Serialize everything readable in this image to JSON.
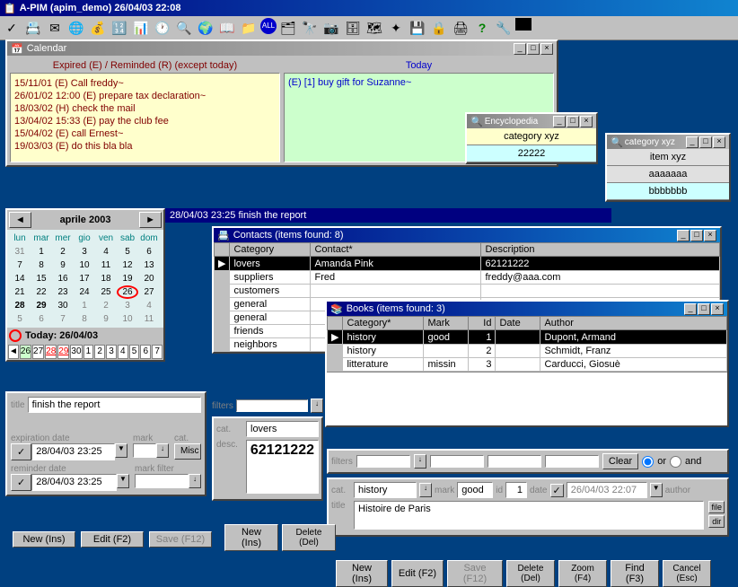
{
  "main_title": "A-PIM (apim_demo) 26/04/03 22:08",
  "calendar": {
    "title": "Calendar",
    "expired_header": "Expired (E) / Reminded (R) (except today)",
    "today_header": "Today",
    "expired_items": [
      "15/11/01 (E) Call freddy~",
      "26/01/02 12:00 (E) prepare tax declaration~",
      "18/03/02 (H) check the mail",
      "13/04/02 15:33 (E) pay the club fee",
      "15/04/02 (E) call Ernest~",
      "19/03/03 (E) do this bla bla"
    ],
    "today_items": [
      "(E) [1] buy gift for Suzanne~"
    ]
  },
  "encyclopedia": {
    "title": "Encyclopedia",
    "rows": [
      "category xyz",
      "22222"
    ]
  },
  "category_popup": {
    "title": "category xyz",
    "items": [
      "item xyz",
      "aaaaaaa",
      "bbbbbbb"
    ]
  },
  "month_task": "28/04/03 23:25 finish the report",
  "month_nav": {
    "label": "aprile 2003",
    "today_label": "Today: 26/04/03"
  },
  "cal_headers": [
    "lun",
    "mar",
    "mer",
    "gio",
    "ven",
    "sab",
    "dom"
  ],
  "cal_weeks": [
    [
      "31",
      "1",
      "2",
      "3",
      "4",
      "5",
      "6"
    ],
    [
      "7",
      "8",
      "9",
      "10",
      "11",
      "12",
      "13"
    ],
    [
      "14",
      "15",
      "16",
      "17",
      "18",
      "19",
      "20"
    ],
    [
      "21",
      "22",
      "23",
      "24",
      "25",
      "26",
      "27"
    ],
    [
      "28",
      "29",
      "30",
      "1",
      "2",
      "3",
      "4"
    ],
    [
      "5",
      "6",
      "7",
      "8",
      "9",
      "10",
      "11"
    ]
  ],
  "day_strip": [
    "",
    "26",
    "27",
    "28",
    "29",
    "30",
    "1",
    "2",
    "3",
    "4",
    "5",
    "6",
    "7"
  ],
  "contacts": {
    "title": "Contacts (items found: 8)",
    "columns": [
      "Category",
      "Contact*",
      "Description"
    ],
    "rows": [
      {
        "category": "lovers",
        "contact": "Amanda Pink",
        "description": "62121222",
        "selected": true
      },
      {
        "category": "suppliers",
        "contact": "Fred",
        "description": "freddy@aaa.com"
      },
      {
        "category": "customers",
        "contact": "",
        "description": ""
      },
      {
        "category": "general",
        "contact": "",
        "description": ""
      },
      {
        "category": "general",
        "contact": "",
        "description": ""
      },
      {
        "category": "friends",
        "contact": "",
        "description": ""
      },
      {
        "category": "neighbors",
        "contact": "",
        "description": ""
      }
    ],
    "filters_label": "filters",
    "cat_label": "cat.",
    "cat_value": "lovers",
    "desc_label": "desc.",
    "desc_value": "62121222"
  },
  "books": {
    "title": "Books (items found: 3)",
    "columns": [
      "Category*",
      "Mark",
      "Id",
      "Date",
      "Author"
    ],
    "rows": [
      {
        "category": "history",
        "mark": "good",
        "id": "1",
        "date": "",
        "author": "Dupont, Armand",
        "selected": true
      },
      {
        "category": "history",
        "mark": "",
        "id": "2",
        "date": "",
        "author": "Schmidt, Franz"
      },
      {
        "category": "litterature",
        "mark": "missin",
        "id": "3",
        "date": "",
        "author": "Carducci, Giosuè"
      }
    ],
    "filters_label": "filters",
    "clear_label": "Clear",
    "or_label": "or",
    "and_label": "and",
    "cat_label": "cat.",
    "cat_value": "history",
    "mark_label": "mark",
    "mark_value": "good",
    "id_label": "id",
    "id_value": "1",
    "date_label": "date",
    "date_value": "26/04/03 22:07",
    "author_label": "author",
    "title_label": "title",
    "title_value": "Histoire de Paris",
    "file_label": "file",
    "dir_label": "dir"
  },
  "form": {
    "title_label": "title",
    "title_value": "finish the report",
    "exp_label": "expiration date",
    "exp_value": "28/04/03 23:25",
    "rem_label": "reminder date",
    "rem_value": "28/04/03 23:25",
    "mark_label": "mark",
    "markfilter_label": "mark filter",
    "cat_label": "cat.",
    "misc_label": "Misc"
  },
  "buttons": {
    "new": "New (Ins)",
    "edit": "Edit (F2)",
    "save": "Save (F12)",
    "delete": "Delete (Del)",
    "zoom": "Zoom (F4)",
    "find": "Find (F3)",
    "cancel": "Cancel (Esc)"
  }
}
